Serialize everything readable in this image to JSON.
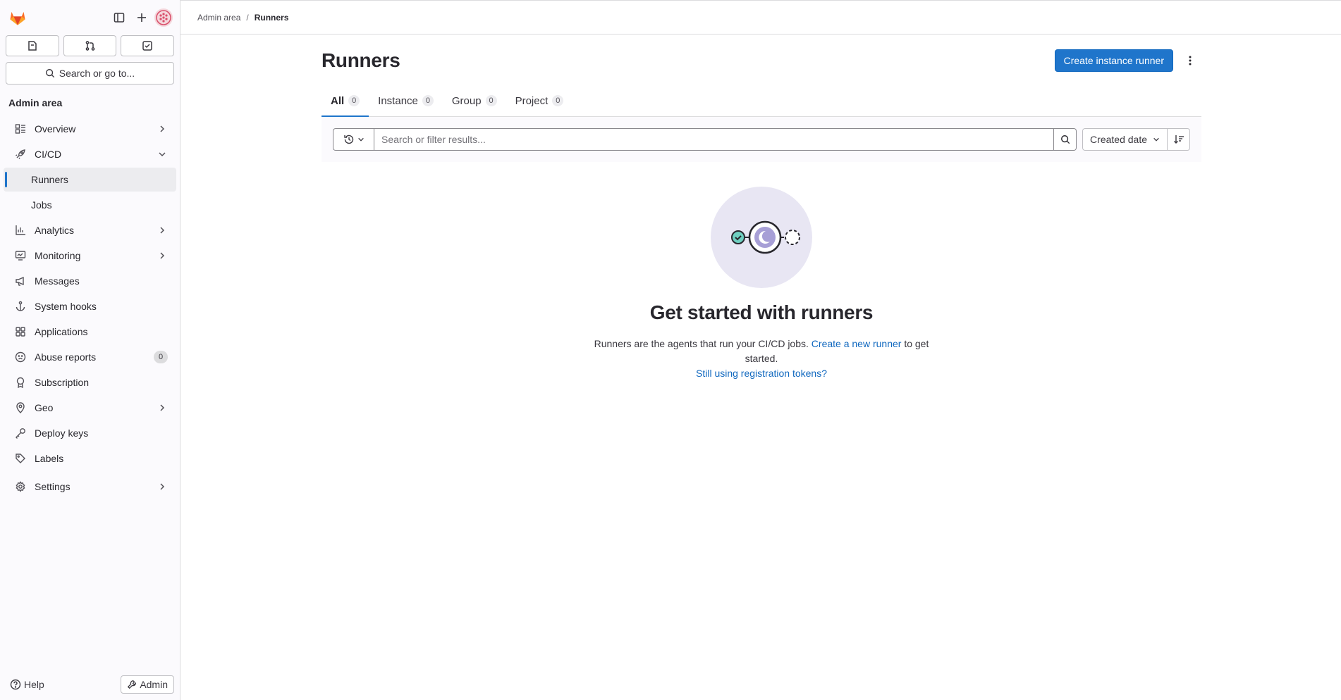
{
  "sidebar": {
    "title": "Admin area",
    "search_label": "Search or go to...",
    "items": [
      {
        "label": "Overview",
        "has_chevron": true
      },
      {
        "label": "CI/CD",
        "expanded": true
      },
      {
        "label": "Runners",
        "active": true
      },
      {
        "label": "Jobs"
      },
      {
        "label": "Analytics",
        "has_chevron": true
      },
      {
        "label": "Monitoring",
        "has_chevron": true
      },
      {
        "label": "Messages"
      },
      {
        "label": "System hooks"
      },
      {
        "label": "Applications"
      },
      {
        "label": "Abuse reports",
        "count": "0"
      },
      {
        "label": "Subscription"
      },
      {
        "label": "Geo",
        "has_chevron": true
      },
      {
        "label": "Deploy keys"
      },
      {
        "label": "Labels"
      },
      {
        "label": "Settings",
        "has_chevron": true
      }
    ],
    "help_label": "Help",
    "admin_label": "Admin"
  },
  "breadcrumb": {
    "parent": "Admin area",
    "separator": "/",
    "current": "Runners"
  },
  "page": {
    "title": "Runners",
    "create_button": "Create instance runner"
  },
  "tabs": [
    {
      "label": "All",
      "count": "0",
      "active": true
    },
    {
      "label": "Instance",
      "count": "0"
    },
    {
      "label": "Group",
      "count": "0"
    },
    {
      "label": "Project",
      "count": "0"
    }
  ],
  "filter": {
    "placeholder": "Search or filter results...",
    "sort_label": "Created date"
  },
  "empty_state": {
    "title": "Get started with runners",
    "text_before": "Runners are the agents that run your CI/CD jobs.",
    "link": "Create a new runner",
    "text_after": "to get started.",
    "secondary_link": "Still using registration tokens?"
  },
  "colors": {
    "primary": "#1f75cb",
    "link": "#1068bf",
    "sidebar_bg": "#fbfafd",
    "illustration_bg": "#e8e6f3",
    "brand_orange": "#e24329"
  }
}
